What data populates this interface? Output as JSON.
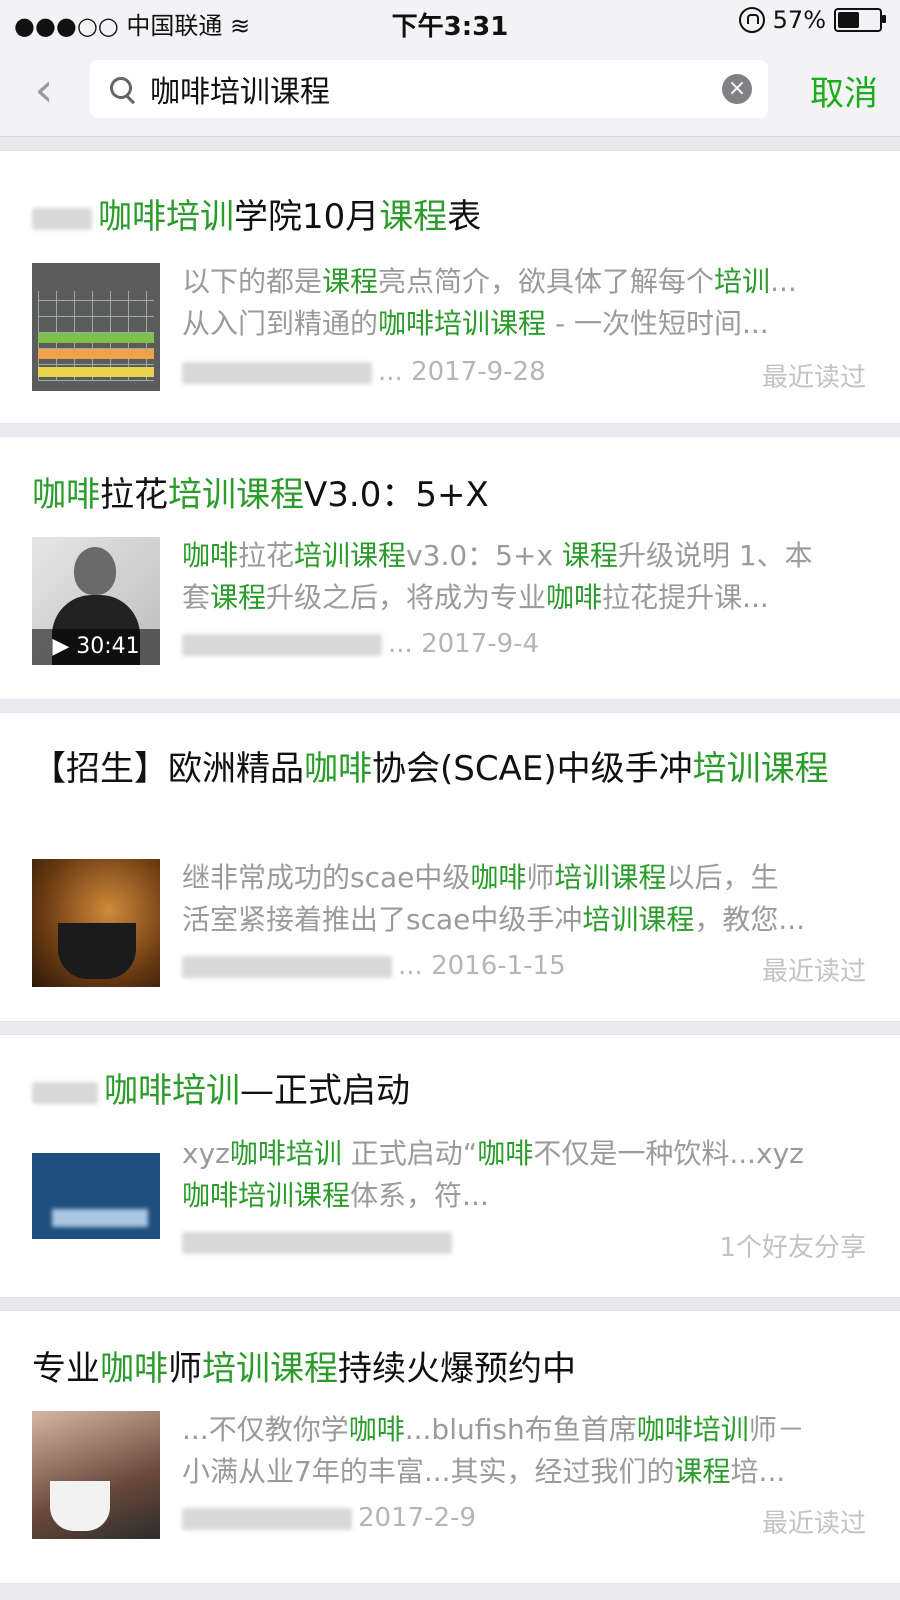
{
  "status_bar": {
    "carrier": "●●●○○ 中国联通",
    "wifi_icon": "wifi-icon",
    "time": "下午3:31",
    "battery_percent": "57%",
    "battery_level": 0.57
  },
  "search": {
    "query": "咖啡培训课程",
    "cancel_label": "取消"
  },
  "colors": {
    "accent": "#1aad19",
    "highlight": "#2b9c2b",
    "muted": "#9b9b9b"
  },
  "results": [
    {
      "title": "咖啡培训学院10月课程表",
      "summary_1": "以下的都是课程亮点简介，欲具体了解每个培训...",
      "summary_2": "从入门到精通的咖啡培训课程 - 一次性短时间...",
      "date": "2017-9-28",
      "status": "最近读过"
    },
    {
      "title": "咖啡拉花培训课程V3.0：5+X",
      "summary_1": "咖啡拉花培训课程v3.0：5+x 课程升级说明 1、本",
      "summary_2": "套课程升级之后，将成为专业咖啡拉花提升课...",
      "duration": "▶ 30:41",
      "date": "2017-9-4",
      "status": ""
    },
    {
      "title": "【招生】欧洲精品咖啡协会(SCAE)中级手冲培训课程",
      "summary_1": "继非常成功的scae中级咖啡师培训课程以后，生",
      "summary_2": "活室紧接着推出了scae中级手冲培训课程，教您...",
      "date": "2016-1-15",
      "status": "最近读过"
    },
    {
      "title": "咖啡培训—正式启动",
      "summary_1": "xyz咖啡培训 正式启动“咖啡不仅是一种饮料...xyz",
      "summary_2": "咖啡培训课程体系，符...",
      "date": "",
      "status": "1个好友分享"
    },
    {
      "title": "专业咖啡师培训课程持续火爆预约中",
      "summary_1": "...不仅教你学咖啡...blufish布鱼首席咖啡培训师－",
      "summary_2": "小满从业7年的丰富...其实，经过我们的课程培...",
      "date": "2017-2-9",
      "status": "最近读过"
    }
  ]
}
